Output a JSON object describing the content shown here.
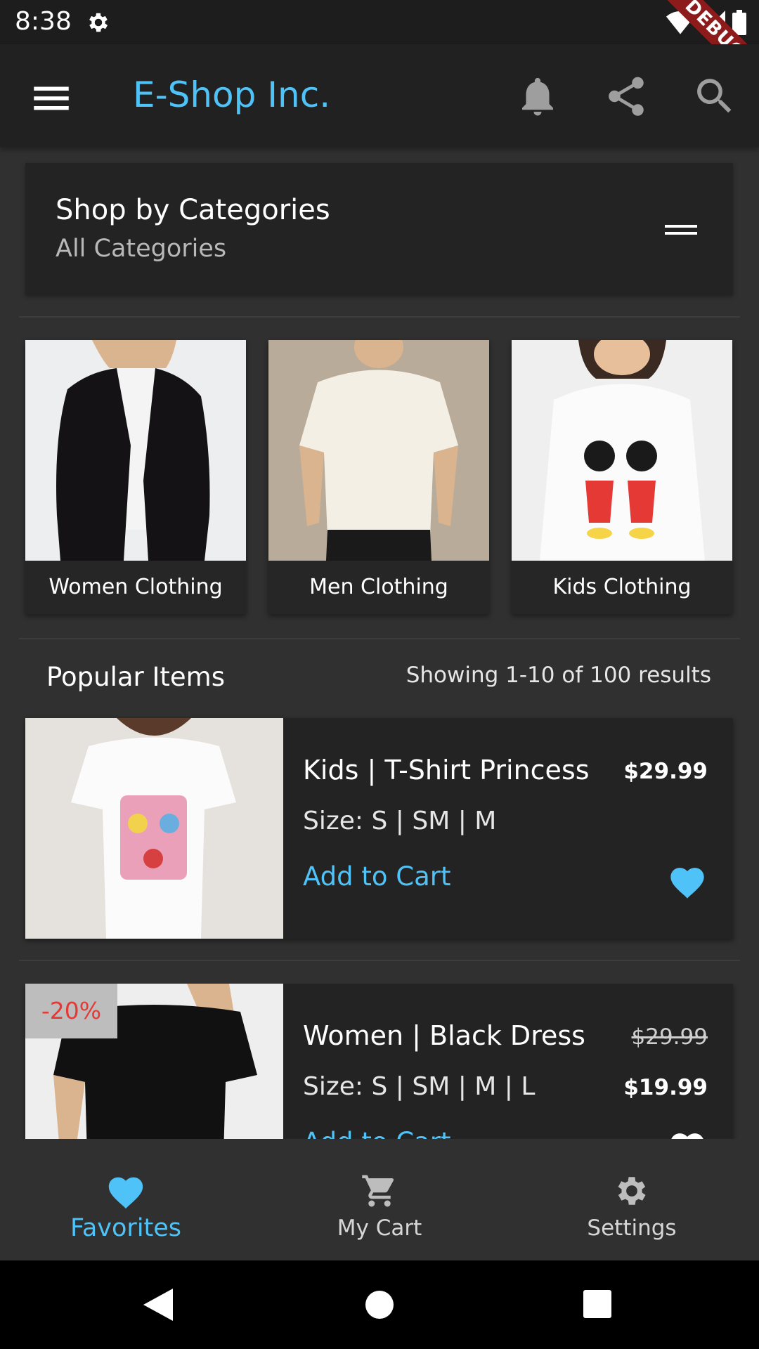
{
  "status_bar": {
    "time": "8:38",
    "debug_label": "DEBUG"
  },
  "app_bar": {
    "title": "E-Shop Inc.",
    "icons": [
      "menu-icon",
      "bell-icon",
      "share-icon",
      "search-icon"
    ],
    "accent_color": "#4fc3f7"
  },
  "categories": {
    "title": "Shop by Categories",
    "subtitle": "All Categories",
    "tiles": [
      {
        "label": "Women Clothing"
      },
      {
        "label": "Men Clothing"
      },
      {
        "label": "Kids Clothing"
      }
    ]
  },
  "popular": {
    "title": "Popular Items",
    "results": "Showing 1-10 of 100 results",
    "items": [
      {
        "name": "Kids | T-Shirt Princess",
        "price": "$29.99",
        "size": "Size: S | SM | M",
        "add_to_cart": "Add to Cart"
      },
      {
        "name": "Women | Black Dress",
        "old_price": "$29.99",
        "price": "$19.99",
        "size": "Size: S | SM | M | L",
        "add_to_cart": "Add to Cart",
        "badge": "-20%"
      }
    ]
  },
  "bottom_nav": {
    "items": [
      {
        "label": "Favorites",
        "icon": "heart-icon",
        "active": true
      },
      {
        "label": "My Cart",
        "icon": "cart-icon",
        "active": false
      },
      {
        "label": "Settings",
        "icon": "gear-icon",
        "active": false
      }
    ]
  }
}
